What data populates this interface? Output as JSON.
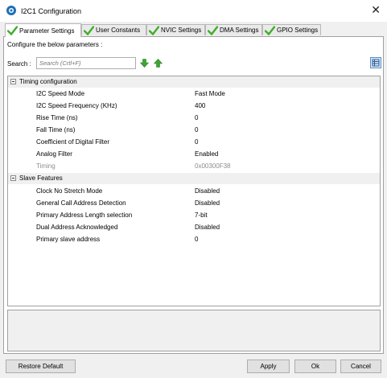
{
  "window": {
    "title": "I2C1 Configuration",
    "close_glyph": "✕"
  },
  "tabs": [
    {
      "label": "Parameter Settings",
      "active": true,
      "icon": "check-icon"
    },
    {
      "label": "User Constants",
      "active": false,
      "icon": "check-icon"
    },
    {
      "label": "NVIC Settings",
      "active": false,
      "icon": "check-icon"
    },
    {
      "label": "DMA Settings",
      "active": false,
      "icon": "check-icon"
    },
    {
      "label": "GPIO Settings",
      "active": false,
      "icon": "check-icon"
    }
  ],
  "configure_text": "Configure the below parameters :",
  "search": {
    "label": "Search :",
    "placeholder": "Search (Crtl+F)"
  },
  "groups": [
    {
      "label": "Timing configuration",
      "rows": [
        {
          "name": "I2C Speed Mode",
          "value": "Fast Mode",
          "enabled": true
        },
        {
          "name": "I2C Speed Frequency (KHz)",
          "value": "400",
          "enabled": true
        },
        {
          "name": "Rise Time (ns)",
          "value": "0",
          "enabled": true
        },
        {
          "name": "Fall Time (ns)",
          "value": "0",
          "enabled": true
        },
        {
          "name": "Coefficient of Digital Filter",
          "value": "0",
          "enabled": true
        },
        {
          "name": "Analog Filter",
          "value": "Enabled",
          "enabled": true
        },
        {
          "name": "Timing",
          "value": "0x00300F38",
          "enabled": false
        }
      ]
    },
    {
      "label": "Slave Features",
      "rows": [
        {
          "name": "Clock No Stretch Mode",
          "value": "Disabled",
          "enabled": true
        },
        {
          "name": "General Call Address Detection",
          "value": "Disabled",
          "enabled": true
        },
        {
          "name": "Primary Address Length selection",
          "value": "7-bit",
          "enabled": true
        },
        {
          "name": "Dual Address Acknowledged",
          "value": "Disabled",
          "enabled": true
        },
        {
          "name": "Primary slave address",
          "value": "0",
          "enabled": true
        }
      ]
    }
  ],
  "buttons": {
    "restore_default": "Restore Default",
    "apply": "Apply",
    "ok": "Ok",
    "cancel": "Cancel"
  },
  "colors": {
    "check_green": "#3fae2a",
    "arrow_green": "#3ea632",
    "group_bg": "#f0f0f0",
    "disabled_text": "#8d8d8d"
  }
}
